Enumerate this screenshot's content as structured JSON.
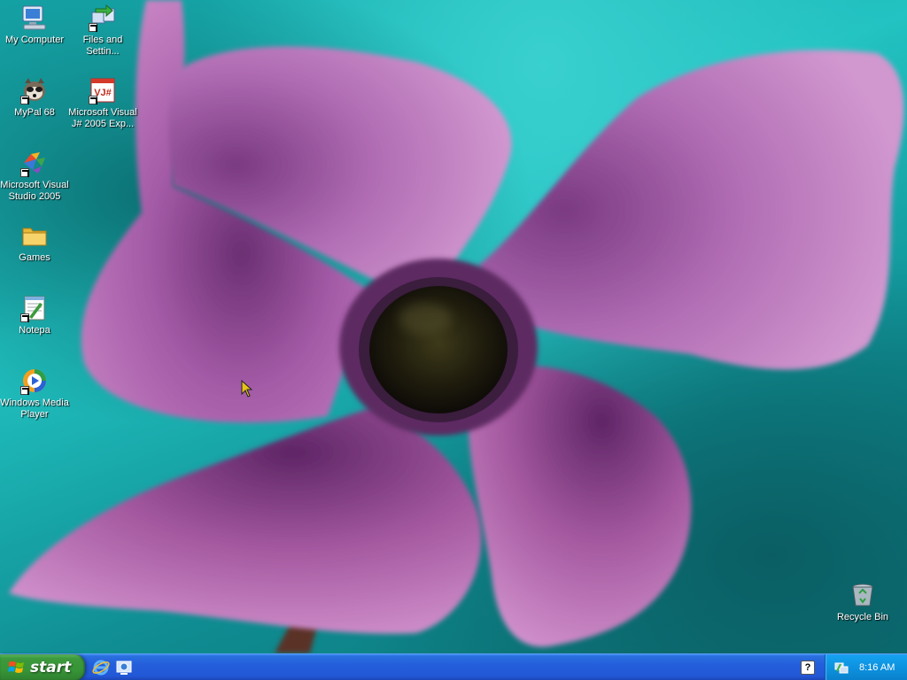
{
  "desktop": {
    "icons_left": [
      {
        "label": "My Computer",
        "icon": "my-computer-icon",
        "shortcut": false
      },
      {
        "label": "Files and Settin...",
        "icon": "files-settings-transfer-icon",
        "shortcut": true
      },
      {
        "label": "MyPal 68",
        "icon": "mypal-browser-icon",
        "shortcut": true
      },
      {
        "label": "Microsoft Visual J# 2005 Exp...",
        "icon": "visual-jsharp-icon",
        "shortcut": true
      },
      {
        "label": "Microsoft Visual Studio 2005",
        "icon": "visual-studio-icon",
        "shortcut": true
      },
      {
        "label": "Games",
        "icon": "folder-icon",
        "shortcut": false
      },
      {
        "label": "Notepa",
        "icon": "notepad-icon",
        "shortcut": true
      },
      {
        "label": "Windows Media Player",
        "icon": "windows-media-player-icon",
        "shortcut": true
      }
    ],
    "recycle_bin": {
      "label": "Recycle Bin",
      "icon": "recycle-bin-icon"
    }
  },
  "taskbar": {
    "start_label": "start",
    "quick_launch": [
      {
        "icon": "internet-explorer-icon"
      },
      {
        "icon": "show-desktop-icon"
      }
    ],
    "help_label": "?",
    "clock": "8:16 AM"
  },
  "colors": {
    "taskbar_blue": "#245edb",
    "start_green": "#3c9a3c",
    "tray_blue": "#0c8edb",
    "wallpaper_teal": "#14a3a6",
    "flower_pink": "#b463b4"
  }
}
